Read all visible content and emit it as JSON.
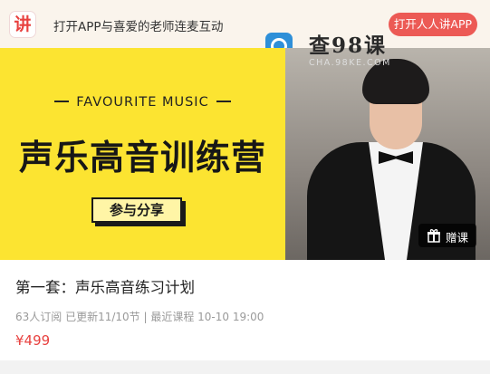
{
  "banner": {
    "app_logo_char": "讲",
    "promo_text": "打开APP与喜爱的老师连麦互动",
    "open_app_label": "打开人人讲APP"
  },
  "watermark": {
    "title": "查98课",
    "subtitle": "CHA.98KE.COM"
  },
  "cover": {
    "tagline": "FAVOURITE MUSIC",
    "camp_title": "声乐高音训练营",
    "share_label": "参与分享",
    "gift_label": "赠课"
  },
  "course": {
    "title": "第一套：声乐高音练习计划",
    "meta": "63人订阅   已更新11/10节 | 最近课程 10-10 19:00",
    "price": "¥499"
  },
  "colors": {
    "accent": "#ec5a55",
    "cover_bg": "#fce431",
    "price": "#e8413f",
    "banner_bg": "#faf4ec"
  }
}
